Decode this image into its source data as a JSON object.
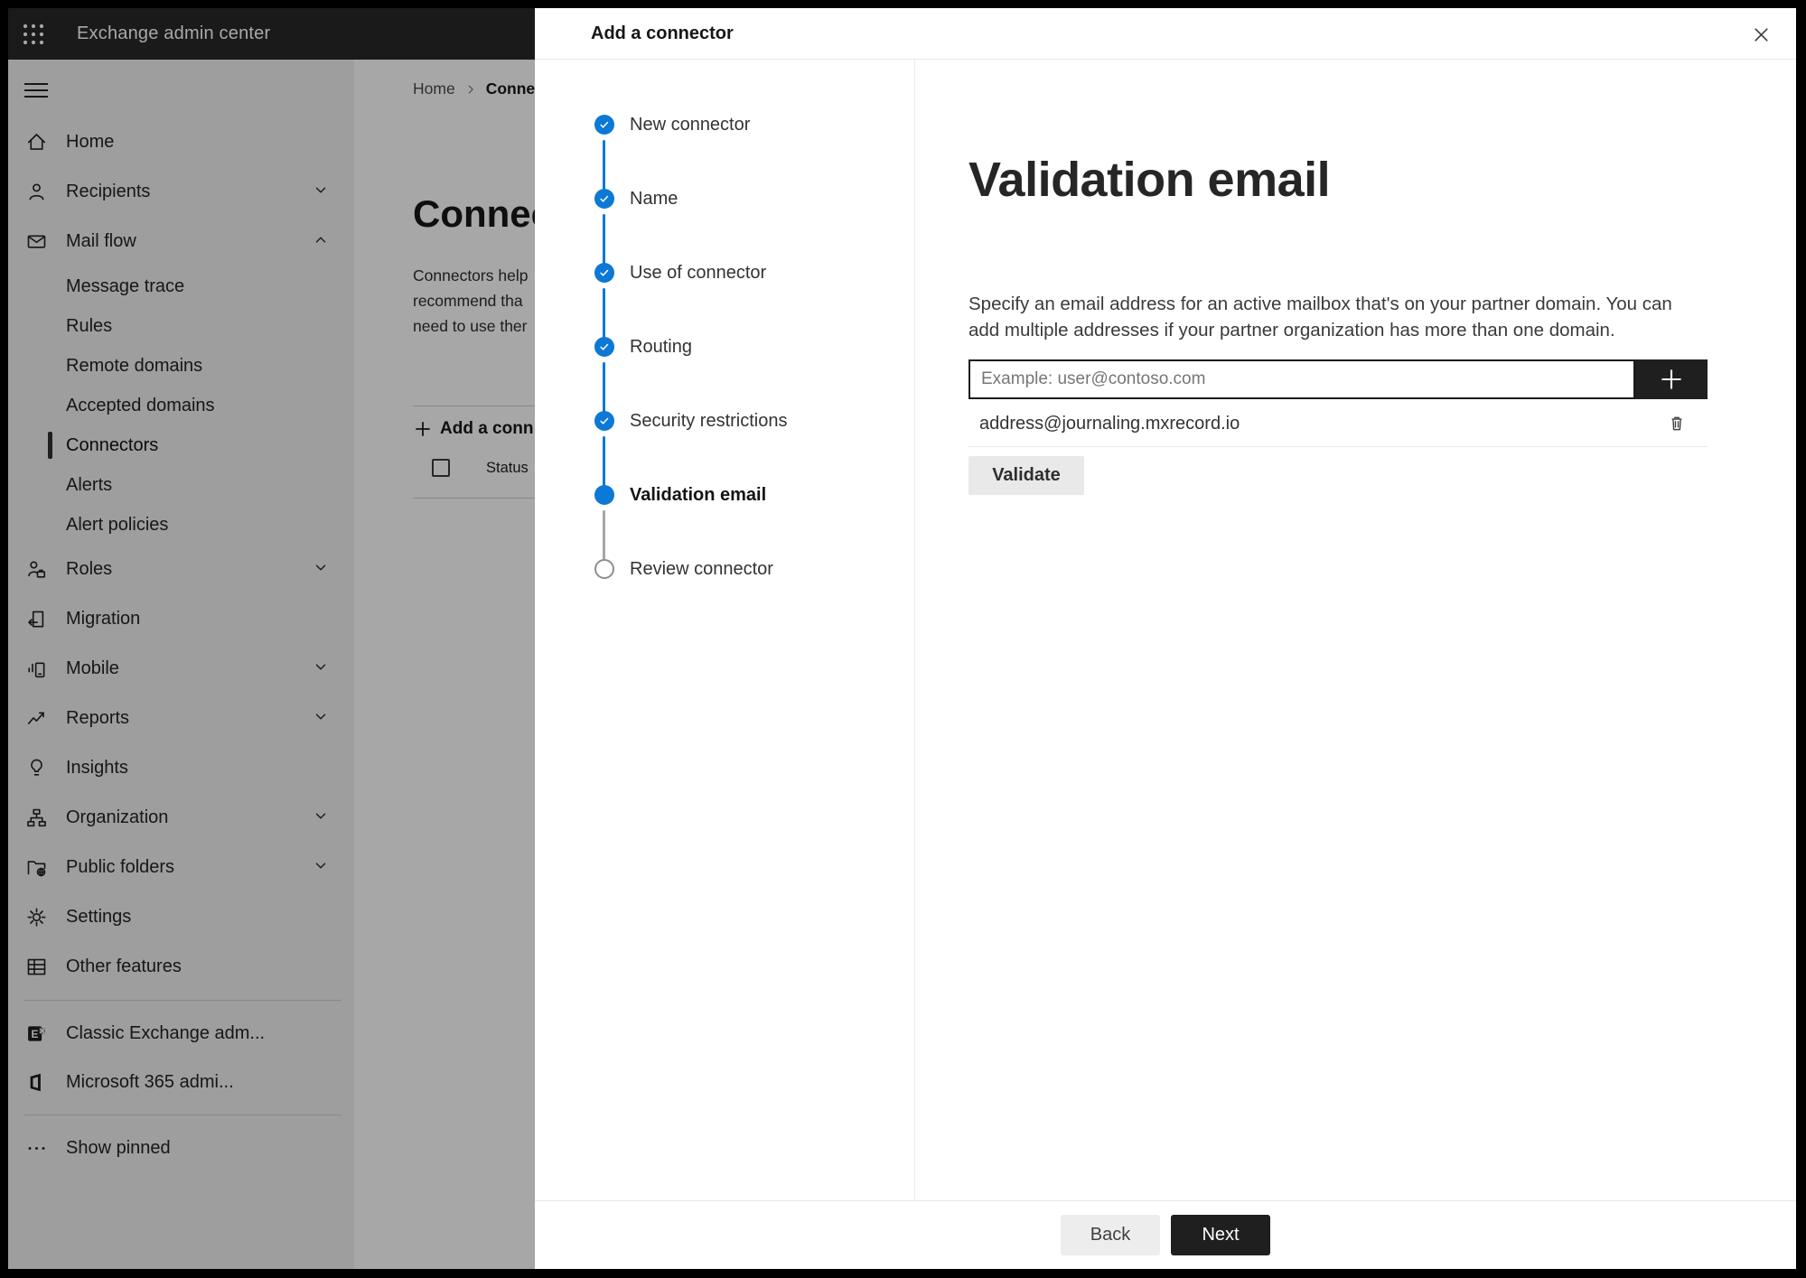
{
  "colors": {
    "accent": "#0b79d5",
    "dark-button": "#1f1f1f",
    "topbar": "#282828"
  },
  "app": {
    "title": "Exchange admin center"
  },
  "sidebar": {
    "items": [
      {
        "label": "Home",
        "icon": "home"
      },
      {
        "label": "Recipients",
        "icon": "person",
        "chevron": "down"
      },
      {
        "label": "Mail flow",
        "icon": "mail",
        "chevron": "up",
        "expanded": true
      },
      {
        "label": "Message trace",
        "sub": true
      },
      {
        "label": "Rules",
        "sub": true
      },
      {
        "label": "Remote domains",
        "sub": true
      },
      {
        "label": "Accepted domains",
        "sub": true
      },
      {
        "label": "Connectors",
        "sub": true,
        "selected": true
      },
      {
        "label": "Alerts",
        "sub": true
      },
      {
        "label": "Alert policies",
        "sub": true
      },
      {
        "label": "Roles",
        "icon": "roles",
        "chevron": "down"
      },
      {
        "label": "Migration",
        "icon": "migration"
      },
      {
        "label": "Mobile",
        "icon": "mobile",
        "chevron": "down"
      },
      {
        "label": "Reports",
        "icon": "reports",
        "chevron": "down"
      },
      {
        "label": "Insights",
        "icon": "lightbulb"
      },
      {
        "label": "Organization",
        "icon": "org-chart",
        "chevron": "down"
      },
      {
        "label": "Public folders",
        "icon": "folder-globe",
        "chevron": "down"
      },
      {
        "label": "Settings",
        "icon": "gear"
      },
      {
        "label": "Other features",
        "icon": "table-grid"
      },
      {
        "label": "Classic Exchange adm...",
        "icon": "exchange-logo"
      },
      {
        "label": "Microsoft 365 admi...",
        "icon": "office-logo"
      },
      {
        "label": "Show pinned",
        "icon": "ellipsis"
      }
    ]
  },
  "background": {
    "breadcrumb": {
      "home": "Home",
      "current": "Conne"
    },
    "heading": "Connec",
    "paragraph_lines": [
      "Connectors help",
      "recommend tha",
      "need to use ther"
    ],
    "add_button_label": "Add a conn",
    "column_header": "Status"
  },
  "modal": {
    "title": "Add a connector",
    "steps": [
      {
        "label": "New connector",
        "state": "complete"
      },
      {
        "label": "Name",
        "state": "complete"
      },
      {
        "label": "Use of connector",
        "state": "complete"
      },
      {
        "label": "Routing",
        "state": "complete"
      },
      {
        "label": "Security restrictions",
        "state": "complete"
      },
      {
        "label": "Validation email",
        "state": "current"
      },
      {
        "label": "Review connector",
        "state": "pending"
      }
    ],
    "content": {
      "heading": "Validation email",
      "description": "Specify an email address for an active mailbox that's on your partner domain. You can add multiple addresses if your partner organization has more than one domain.",
      "email_input": {
        "value": "",
        "placeholder": "Example: user@contoso.com"
      },
      "addresses": [
        "address@journaling.mxrecord.io"
      ],
      "validate_label": "Validate"
    },
    "footer": {
      "back_label": "Back",
      "next_label": "Next"
    }
  }
}
